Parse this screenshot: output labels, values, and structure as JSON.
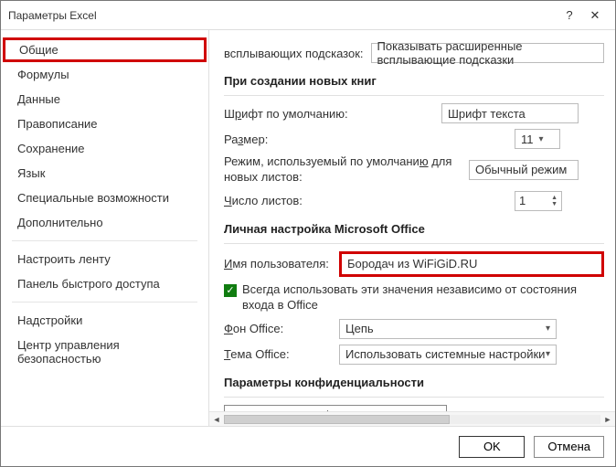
{
  "window": {
    "title": "Параметры Excel"
  },
  "sidebar": {
    "items": [
      {
        "label": "Общие",
        "selected": true
      },
      {
        "label": "Формулы"
      },
      {
        "label": "Данные"
      },
      {
        "label": "Правописание"
      },
      {
        "label": "Сохранение"
      },
      {
        "label": "Язык"
      },
      {
        "label": "Специальные возможности"
      },
      {
        "label": "Дополнительно"
      }
    ],
    "items2": [
      {
        "label": "Настроить ленту"
      },
      {
        "label": "Панель быстрого доступа"
      }
    ],
    "items3": [
      {
        "label": "Надстройки"
      },
      {
        "label": "Центр управления безопасностью"
      }
    ]
  },
  "content": {
    "tooltips": {
      "label": "всплывающих подсказок:",
      "value": "Показывать расширенные всплывающие подсказки"
    },
    "section_newbook": "При создании новых книг",
    "font": {
      "label_pre": "Ш",
      "label_u": "р",
      "label_post": "ифт по умолчанию:",
      "value": "Шрифт текста"
    },
    "size": {
      "label_pre": "Ра",
      "label_u": "з",
      "label_post": "мер:",
      "value": "11"
    },
    "mode": {
      "label_pre": "Режим, используемый по умолчани",
      "label_u": "ю",
      "label_post": " для новых листов:",
      "value": "Обычный режим"
    },
    "sheets": {
      "label_pre": "",
      "label_u": "Ч",
      "label_post": "исло листов:",
      "value": "1"
    },
    "section_personal": "Личная настройка Microsoft Office",
    "username": {
      "label_pre": "",
      "label_u": "И",
      "label_post": "мя пользователя:",
      "value": "Бородач из WiFiGiD.RU"
    },
    "always_use": {
      "checked": true,
      "label": "Всегда использовать эти значения независимо от состояния входа в Office"
    },
    "bg": {
      "label_pre": "",
      "label_u": "Ф",
      "label_post": "он Office:",
      "value": "Цепь"
    },
    "theme": {
      "label_pre": "",
      "label_u": "Т",
      "label_post": "ема Office:",
      "value": "Использовать системные настройки"
    },
    "section_privacy": "Параметры конфиденциальности",
    "privacy_btn": "Параметры конфиденциальности..."
  },
  "footer": {
    "ok": "OK",
    "cancel": "Отмена"
  }
}
